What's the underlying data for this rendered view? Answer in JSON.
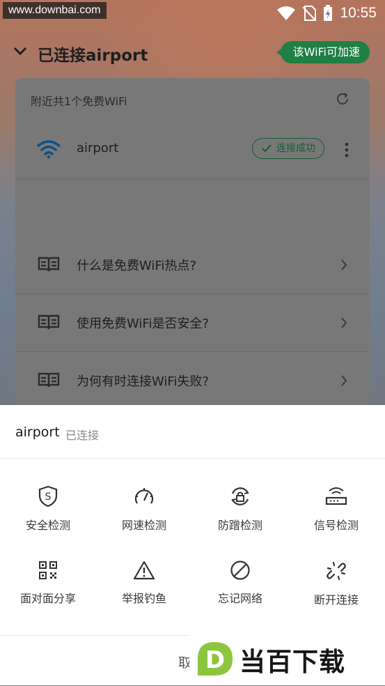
{
  "watermark": "www.downbai.com",
  "status_bar": {
    "time": "10:55"
  },
  "header": {
    "title": "已连接airport",
    "accelerate_label": "该WiFi可加速"
  },
  "card": {
    "nearby_text": "附近共1个免费WiFi",
    "network": {
      "ssid": "airport",
      "status": "连接成功"
    },
    "faq": [
      {
        "question": "什么是免费WiFi热点?"
      },
      {
        "question": "使用免费WiFi是否安全?"
      },
      {
        "question": "为何有时连接WiFi失败?"
      }
    ]
  },
  "sheet": {
    "network_name": "airport",
    "network_state": "已连接",
    "actions": [
      {
        "label": "安全检测",
        "icon": "shield-s-icon"
      },
      {
        "label": "网速检测",
        "icon": "speedometer-icon"
      },
      {
        "label": "防蹭检测",
        "icon": "lock-refresh-icon"
      },
      {
        "label": "信号检测",
        "icon": "router-signal-icon"
      },
      {
        "label": "面对面分享",
        "icon": "qr-code-icon"
      },
      {
        "label": "举报钓鱼",
        "icon": "warning-icon"
      },
      {
        "label": "忘记网络",
        "icon": "forbidden-icon"
      },
      {
        "label": "断开连接",
        "icon": "broken-link-icon"
      }
    ],
    "cancel_label": "取"
  },
  "brand": {
    "text": "当百下载",
    "logo_letter": "D"
  },
  "colors": {
    "accent_green": "#1f7f44",
    "wifi_blue": "#0d4f86",
    "sheet_bg": "#ffffff"
  }
}
